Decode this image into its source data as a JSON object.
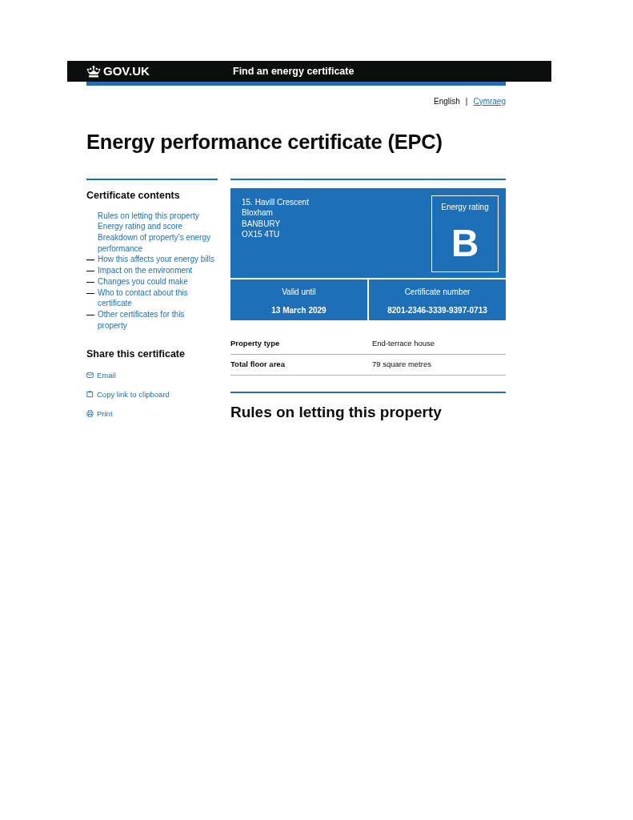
{
  "header": {
    "logo": "GOV.UK",
    "service": "Find an energy certificate"
  },
  "language": {
    "options": [
      {
        "label": "English",
        "selected": true
      },
      {
        "label": "Cymraeg",
        "selected": false
      }
    ],
    "separator": "|"
  },
  "title": "Energy performance certificate (EPC)",
  "contents": {
    "heading": "Certificate contents",
    "items": [
      {
        "label": "Rules on letting this property",
        "dashed": false
      },
      {
        "label": "Energy rating and score",
        "dashed": false
      },
      {
        "label": "Breakdown of property’s energy performance",
        "dashed": false
      },
      {
        "label": "How this affects your energy bills",
        "dashed": true
      },
      {
        "label": "Impact on the environment",
        "dashed": true
      },
      {
        "label": "Changes you could make",
        "dashed": true
      },
      {
        "label": "Who to contact about this certificate",
        "dashed": true
      },
      {
        "label": "Other certificates for this property",
        "dashed": true
      }
    ]
  },
  "share": {
    "heading": "Share this certificate",
    "items": [
      {
        "label": "Email",
        "kind": "email"
      },
      {
        "label": "Copy link to clipboard",
        "kind": "copy"
      },
      {
        "label": "Print",
        "kind": "print"
      }
    ]
  },
  "certificate": {
    "address": [
      "15. Havill Crescent",
      "Bloxham",
      "BANBURY",
      "OX15 4TU"
    ],
    "rating_label": "Energy rating",
    "rating": "B",
    "valid_label": "Valid until",
    "valid_until": "13 March 2029",
    "number_label": "Certificate number",
    "number": "8201-2346-3339-9397-0713"
  },
  "summary": [
    {
      "key": "Property type",
      "value": "End-terrace house"
    },
    {
      "key": "Total floor area",
      "value": "79 square metres"
    }
  ],
  "section_heading": "Rules on letting this property"
}
